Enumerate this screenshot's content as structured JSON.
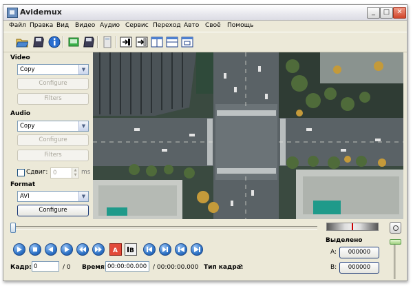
{
  "window": {
    "title": "Avidemux"
  },
  "menu": [
    "Файл",
    "Правка",
    "Вид",
    "Видео",
    "Аудио",
    "Сервис",
    "Переход",
    "Авто",
    "Своё",
    "Помощь"
  ],
  "toolbar": {
    "icons": [
      "open-icon",
      "save-icon",
      "info-icon",
      "save-video-icon",
      "save-audio-icon",
      "calculator-icon",
      "input-mode-icon",
      "output-mode-icon",
      "side-by-side-icon",
      "top-bottom-icon",
      "window-icon"
    ]
  },
  "video": {
    "label": "Video",
    "codec": "Copy",
    "configure": "Configure",
    "filters": "Filters"
  },
  "audio": {
    "label": "Audio",
    "codec": "Copy",
    "configure": "Configure",
    "filters": "Filters",
    "shift_label": "Сдвиг:",
    "shift_value": "0",
    "shift_unit": "ms"
  },
  "format": {
    "label": "Format",
    "container": "AVI",
    "configure": "Configure"
  },
  "playback": {
    "icons": [
      "play-icon",
      "stop-icon",
      "prev-frame-icon",
      "next-frame-icon",
      "prev-keyframe-icon",
      "next-keyframe-icon",
      "set-marker-a-icon",
      "set-marker-b-icon",
      "prev-black-icon",
      "next-black-icon",
      "goto-start-icon",
      "goto-end-icon"
    ]
  },
  "status": {
    "frame_label": "Кадр:",
    "frame_value": "0",
    "frame_total": "/ 0",
    "time_label": "Время:",
    "time_value": "00:00:00.000",
    "time_total": "/ 00:00:00.000",
    "frame_type_label": "Тип кадра:",
    "frame_type_value": "?"
  },
  "selection": {
    "title": "Выделено",
    "a_label": "A:",
    "a_value": "000000",
    "b_label": "B:",
    "b_value": "000000"
  }
}
